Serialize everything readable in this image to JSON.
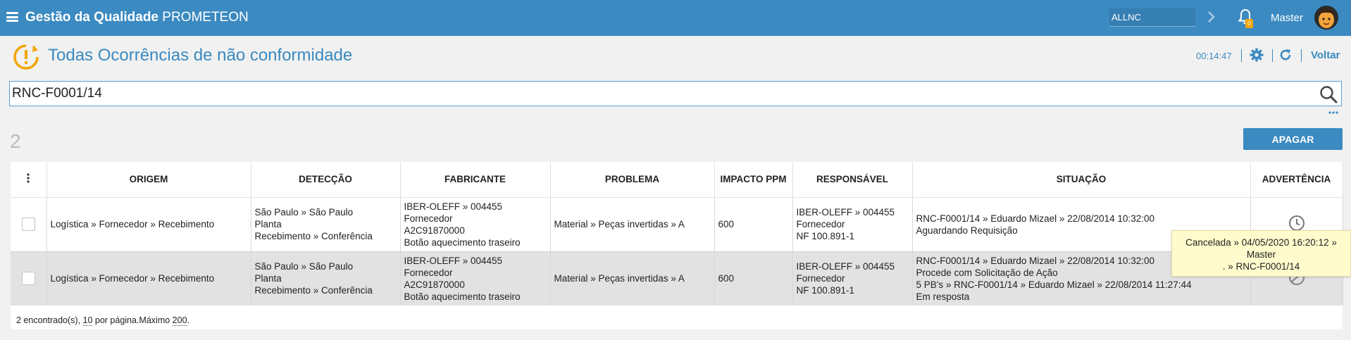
{
  "header": {
    "brand_bold": "Gestão da Qualidade",
    "brand_rest": " PROMETEON",
    "org_value": "ALLNC",
    "notification_count": "0",
    "user_name": "Master"
  },
  "page": {
    "title": "Todas Ocorrências de não conformidade",
    "clock": "00:14:47",
    "back_label": "Voltar"
  },
  "search": {
    "value": "RNC-F0001/14"
  },
  "results": {
    "count": "2",
    "delete_label": "APAGAR"
  },
  "table": {
    "columns": [
      "ORIGEM",
      "DETECÇÃO",
      "FABRICANTE",
      "PROBLEMA",
      "IMPACTO PPM",
      "RESPONSÁVEL",
      "SITUAÇÃO",
      "ADVERTÊNCIA"
    ],
    "rows": [
      {
        "origem": "Logística » Fornecedor » Recebimento",
        "deteccao": [
          "São Paulo » São Paulo",
          "Planta",
          "Recebimento » Conferência"
        ],
        "fabricante": [
          "IBER-OLEFF » 004455",
          "Fornecedor",
          "A2C91870000",
          "Botão aquecimento traseiro"
        ],
        "problema": "Material » Peças invertidas » A",
        "impacto": "600",
        "responsavel": [
          "IBER-OLEFF » 004455",
          "Fornecedor",
          "NF 100.891-1"
        ],
        "situacao": [
          "RNC-F0001/14 » Eduardo Mizael » 22/08/2014 10:32:00",
          "Aguardando Requisição"
        ],
        "warning_icon": "clock-icon"
      },
      {
        "origem": "Logística » Fornecedor » Recebimento",
        "deteccao": [
          "São Paulo » São Paulo",
          "Planta",
          "Recebimento » Conferência"
        ],
        "fabricante": [
          "IBER-OLEFF » 004455",
          "Fornecedor",
          "A2C91870000",
          "Botão aquecimento traseiro"
        ],
        "problema": "Material » Peças invertidas » A",
        "impacto": "600",
        "responsavel": [
          "IBER-OLEFF » 004455",
          "Fornecedor",
          "NF 100.891-1"
        ],
        "situacao": [
          "RNC-F0001/14 » Eduardo Mizael » 22/08/2014 10:32:00",
          "Procede com Solicitação de Ação",
          "5 PB's » RNC-F0001/14 » Eduardo Mizael » 22/08/2014 11:27:44",
          "Em resposta"
        ],
        "warning_icon": "cancel-icon"
      }
    ]
  },
  "footer": {
    "found": "2 encontrado(s), ",
    "per_page_num": "10",
    "per_page_text": " por página.Máximo ",
    "max_num": "200",
    "end": "."
  },
  "tooltip": {
    "lines": [
      "Cancelada » 04/05/2020 16:20:12 »",
      "Master",
      ". » RNC-F0001/14"
    ]
  },
  "colors": {
    "primary": "#3b8ac1",
    "page_bg": "#f1f1f1",
    "tooltip_bg": "#fffbcc",
    "warning_orange": "#f0a500"
  }
}
